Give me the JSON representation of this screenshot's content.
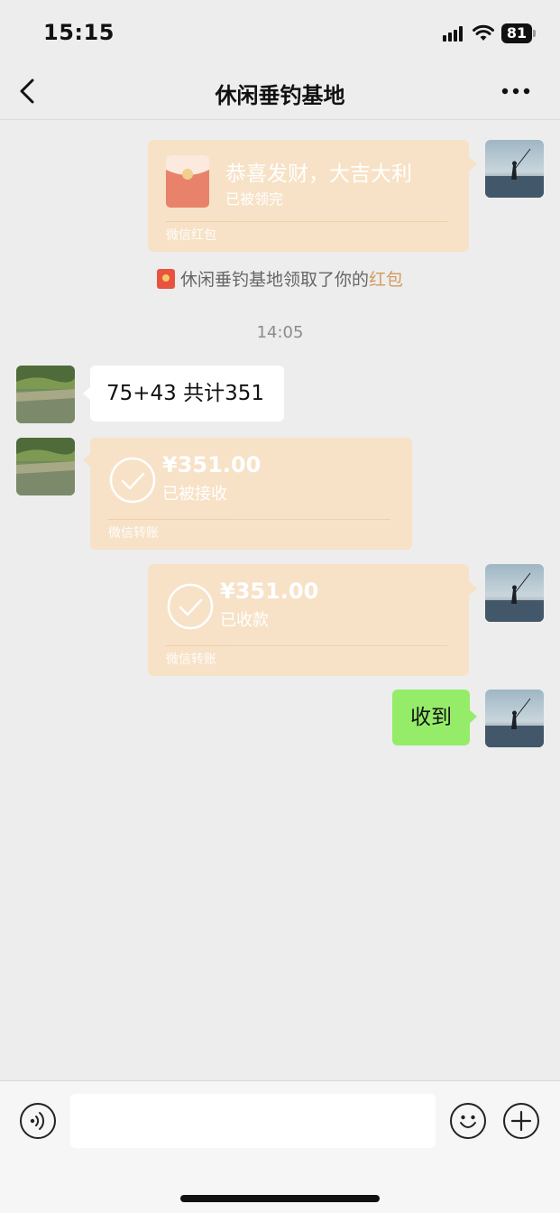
{
  "status_bar": {
    "time": "15:15",
    "battery": "81"
  },
  "header": {
    "title": "休闲垂钓基地"
  },
  "messages": {
    "red_packet": {
      "greeting": "恭喜发财，大吉大利",
      "status": "已被领完",
      "footer": "微信红包"
    },
    "system_notice": {
      "prefix": "休闲垂钓基地领取了你的",
      "link": "红包"
    },
    "timestamp": "14:05",
    "text_in": "75+43   共计351",
    "transfer_in": {
      "amount": "¥351.00",
      "status": "已被接收",
      "footer": "微信转账"
    },
    "transfer_out": {
      "amount": "¥351.00",
      "status": "已收款",
      "footer": "微信转账"
    },
    "text_out": "收到"
  },
  "input_bar": {
    "placeholder": ""
  },
  "colors": {
    "background": "#ededed",
    "card": "#f7e2c7",
    "green_bubble": "#95ec69",
    "link": "#d39b5e"
  },
  "icons": {
    "voice": "voice-icon",
    "emoji": "emoji-icon",
    "plus": "plus-icon",
    "back": "back-arrow-icon",
    "more": "more-icon"
  }
}
